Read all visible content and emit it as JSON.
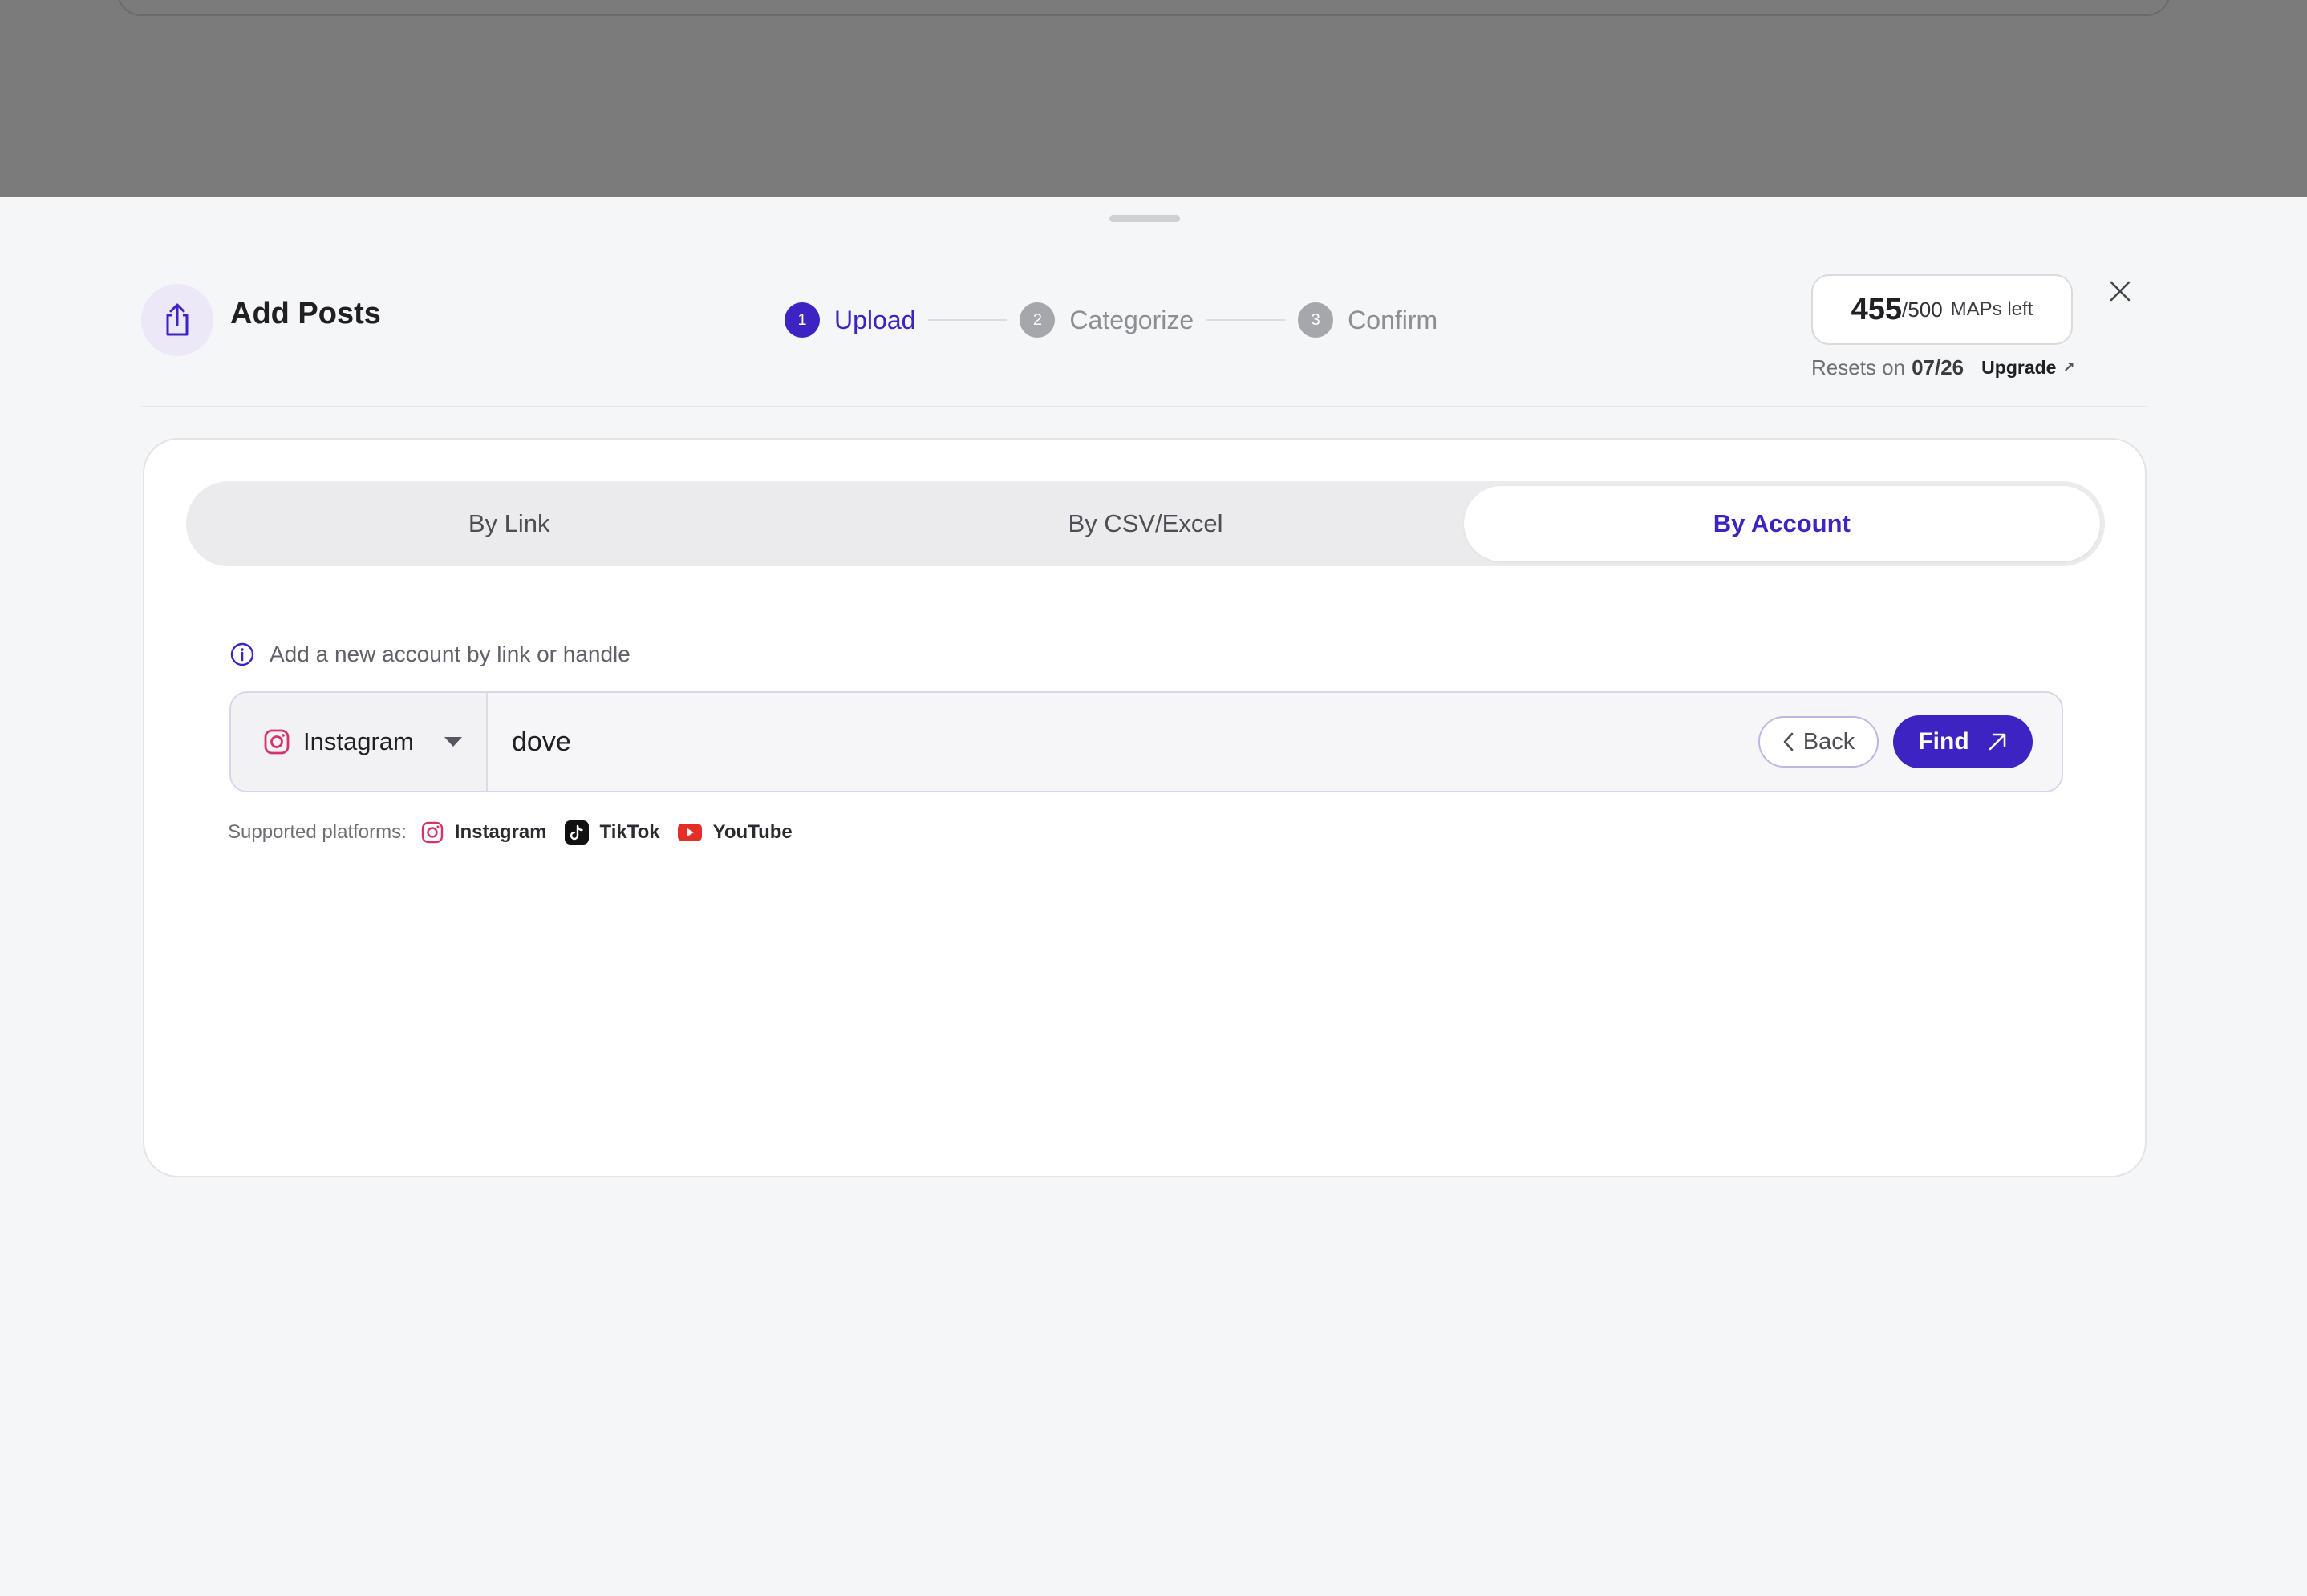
{
  "header": {
    "title": "Add Posts",
    "steps": [
      {
        "number": "1",
        "label": "Upload",
        "active": true
      },
      {
        "number": "2",
        "label": "Categorize",
        "active": false
      },
      {
        "number": "3",
        "label": "Confirm",
        "active": false
      }
    ],
    "maps": {
      "count": "455",
      "total": "/500",
      "suffix": "MAPs left",
      "resets_prefix": "Resets on",
      "resets_date": "07/26",
      "upgrade_label": "Upgrade"
    }
  },
  "tabs": [
    {
      "label": "By Link",
      "active": false
    },
    {
      "label": "By CSV/Excel",
      "active": false
    },
    {
      "label": "By Account",
      "active": true
    }
  ],
  "account_form": {
    "info_text": "Add a new account by link or handle",
    "platform_selected": "Instagram",
    "handle_value": "dove",
    "back_label": "Back",
    "find_label": "Find"
  },
  "supported": {
    "label": "Supported platforms:",
    "platforms": [
      {
        "name": "Instagram",
        "icon": "instagram-icon"
      },
      {
        "name": "TikTok",
        "icon": "tiktok-icon"
      },
      {
        "name": "YouTube",
        "icon": "youtube-icon"
      }
    ]
  },
  "colors": {
    "accent": "#3d23c2",
    "background": "#f5f6f8",
    "backdrop": "#7b7b7b",
    "instagram": "#d6336c",
    "youtube": "#e52d27"
  }
}
